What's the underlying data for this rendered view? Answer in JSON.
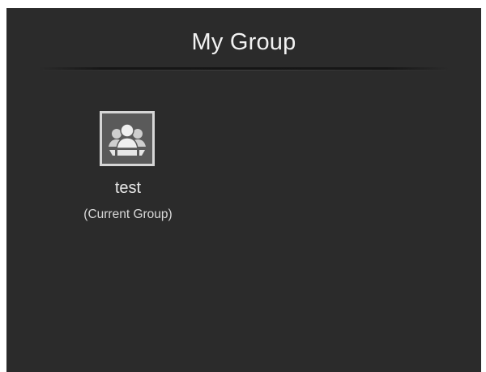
{
  "header": {
    "title": "My Group"
  },
  "groups": [
    {
      "name": "test",
      "status": "(Current Group)",
      "icon": "group-people-icon"
    }
  ],
  "colors": {
    "background": "#2b2b2b",
    "text": "#f2f2f2",
    "icon_frame": "#d6d6d6"
  }
}
